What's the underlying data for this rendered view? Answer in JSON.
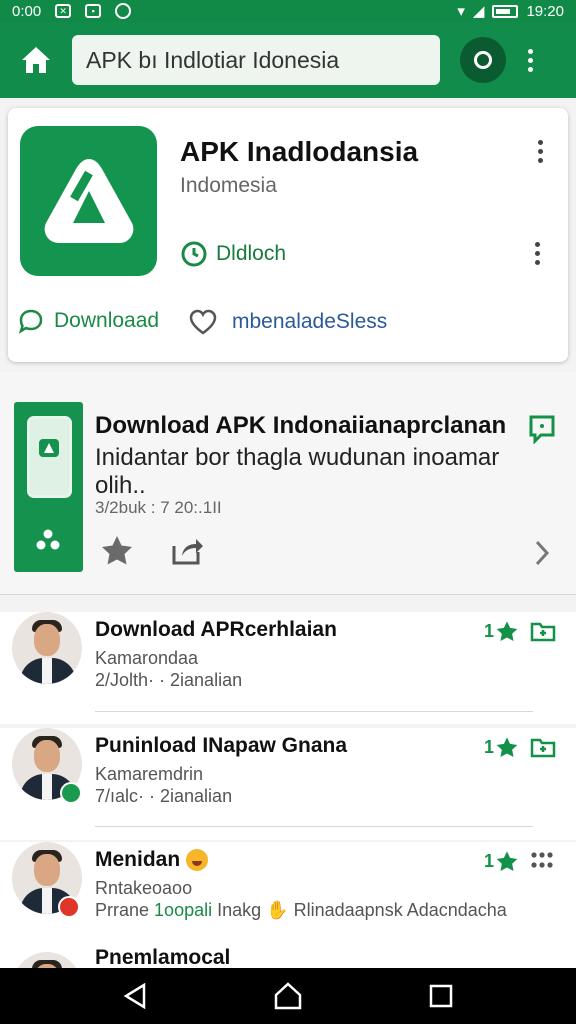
{
  "status_bar": {
    "time": "0:00",
    "clock": "19:20"
  },
  "app_bar": {
    "search_text": "APK bı Indlotiar Idonesia"
  },
  "app_card": {
    "title": "APK Inadlodansia",
    "subtitle": "Indomesia",
    "meta": "Dldloch",
    "download_label": "Downloaad",
    "favorite_label": "mbenaladeSless"
  },
  "featured": {
    "title": "Download APK Indonaiianaprclanan",
    "description": "Inidantar bor thagla wudunan inoamar olih..",
    "meta": "3/2buk : 7 20:.1II"
  },
  "list": [
    {
      "title": "Download APRcerhlaian",
      "subtitle": "Kamarondaa",
      "meta": "2/Jolth· · 2ianalian",
      "rating": "1"
    },
    {
      "title": "Puninload INapaw Gnana",
      "subtitle": "Kamaremdrin",
      "meta": "7/ıalc· · 2ianalian",
      "rating": "1"
    },
    {
      "title": "Menidan",
      "subtitle": "Rntakeoaoo",
      "meta_before": "Prrane",
      "meta_highlight": "1oopali",
      "meta_after": "Inakg",
      "meta_tail": "Rlinadaapnsk Adacndacha",
      "rating": "1"
    },
    {
      "title": "Pnemlamocal"
    }
  ],
  "colors": {
    "primary": "#128c4a",
    "primary_dark": "#0b5b31",
    "link_blue": "#2a5a9a"
  },
  "icons": [
    "home-icon",
    "circle-icon",
    "more-vert-icon",
    "app-logo-icon",
    "clock-icon",
    "chat-icon",
    "heart-icon",
    "chat-box-icon",
    "star-icon",
    "share-icon",
    "chevron-right-icon",
    "bookmark-icon",
    "grid-dots-icon",
    "back-icon",
    "home-nav-icon",
    "recents-icon"
  ]
}
